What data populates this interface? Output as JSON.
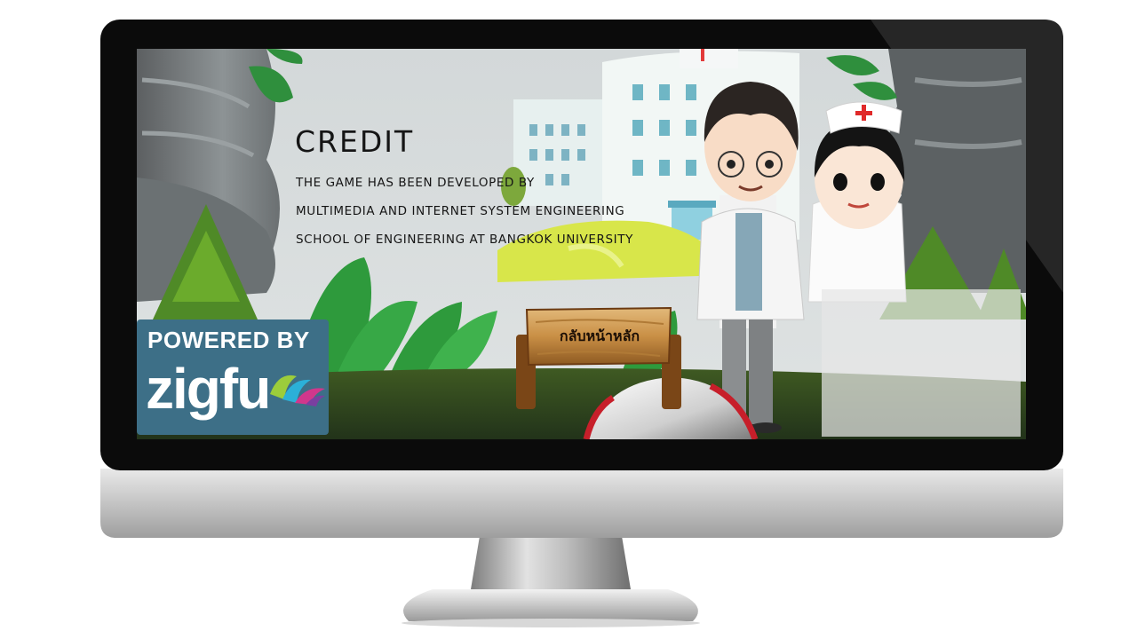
{
  "credit": {
    "title": "CREDIT",
    "lines": [
      "THE GAME HAS BEEN DEVELOPED BY",
      "MULTIMEDIA AND INTERNET SYSTEM ENGINEERING",
      "SCHOOL OF ENGINEERING AT BANGKOK UNIVERSITY"
    ]
  },
  "back_button": {
    "label": "กลับหน้าหลัก"
  },
  "zigfu": {
    "powered_by": "POWERED BY",
    "brand": "zigfu"
  },
  "colors": {
    "badge": "#3d6f87",
    "screen_bg": "#d7dcdd",
    "monitor_bezel": "#0b0b0b",
    "monitor_chin": "#c9c9c9"
  }
}
